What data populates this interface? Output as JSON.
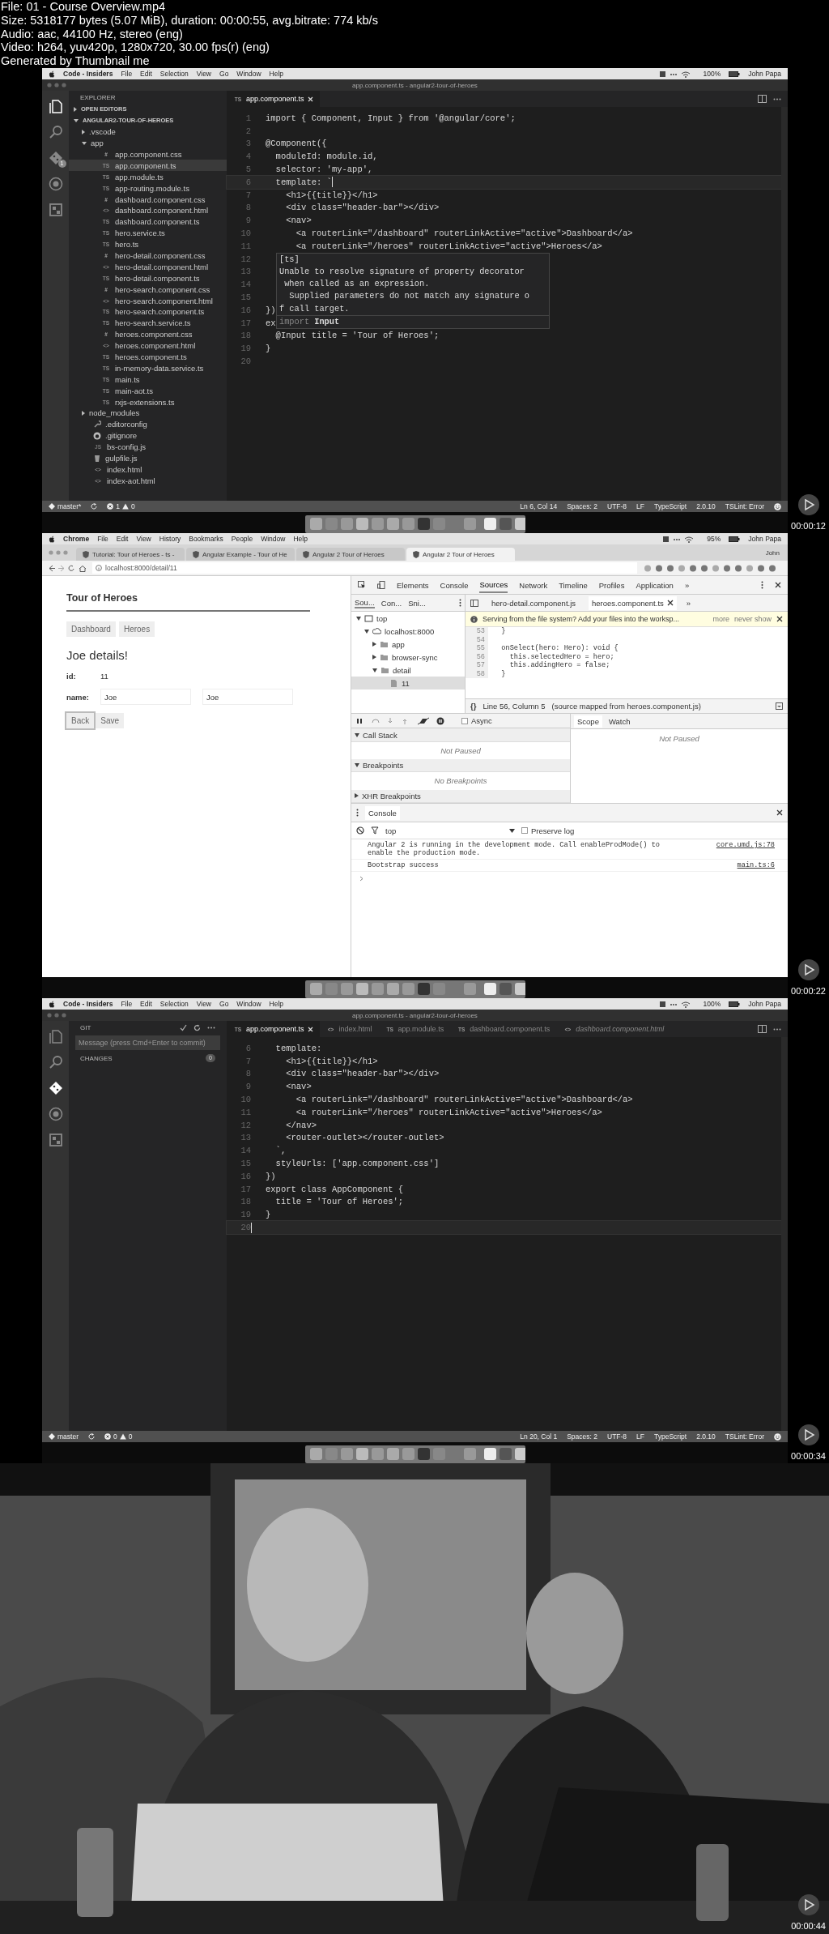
{
  "file_info": [
    "File: 01 - Course Overview.mp4",
    "Size: 5318177 bytes (5.07 MiB), duration: 00:00:55, avg.bitrate: 774 kb/s",
    "Audio: aac, 44100 Hz, stereo (eng)",
    "Video: h264, yuv420p, 1280x720, 30.00 fps(r) (eng)",
    "Generated by Thumbnail me"
  ],
  "frames": [
    {
      "kind": "vscode",
      "timestamp": "00:00:12",
      "menu_bar": {
        "app": "Code - Insiders",
        "items": [
          "File",
          "Edit",
          "Selection",
          "View",
          "Go",
          "Window",
          "Help"
        ],
        "battery": "100%",
        "user": "John Papa"
      },
      "window_title": "app.component.ts - angular2-tour-of-heroes",
      "activity": [
        {
          "kind": "files",
          "selected": true
        },
        {
          "kind": "search",
          "selected": false
        },
        {
          "kind": "git",
          "selected": false,
          "badge": "1"
        },
        {
          "kind": "debug",
          "selected": false
        },
        {
          "kind": "extensions",
          "selected": false
        }
      ],
      "sidebar": {
        "kind": "explorer",
        "title": "EXPLORER",
        "sections": [
          {
            "label": "OPEN EDITORS",
            "expanded": false
          },
          {
            "label": "ANGULAR2-TOUR-OF-HEROES",
            "expanded": true
          }
        ],
        "tree": [
          {
            "label": ".vscode",
            "kind": "folder",
            "expanded": false,
            "selected": false
          },
          {
            "label": "app",
            "kind": "folder",
            "expanded": true,
            "selected": false,
            "children": [
              {
                "label": "app.component.css",
                "kind": "css",
                "icon": "#",
                "selected": false
              },
              {
                "label": "app.component.ts",
                "kind": "ts",
                "icon": "TS",
                "selected": true
              },
              {
                "label": "app.module.ts",
                "kind": "ts",
                "icon": "TS",
                "selected": false
              },
              {
                "label": "app-routing.module.ts",
                "kind": "ts",
                "icon": "TS",
                "selected": false
              },
              {
                "label": "dashboard.component.css",
                "kind": "css",
                "icon": "#",
                "selected": false
              },
              {
                "label": "dashboard.component.html",
                "kind": "html",
                "icon": "<>",
                "selected": false
              },
              {
                "label": "dashboard.component.ts",
                "kind": "ts",
                "icon": "TS",
                "selected": false
              },
              {
                "label": "hero.service.ts",
                "kind": "ts",
                "icon": "TS",
                "selected": false
              },
              {
                "label": "hero.ts",
                "kind": "ts",
                "icon": "TS",
                "selected": false
              },
              {
                "label": "hero-detail.component.css",
                "kind": "css",
                "icon": "#",
                "selected": false
              },
              {
                "label": "hero-detail.component.html",
                "kind": "html",
                "icon": "<>",
                "selected": false
              },
              {
                "label": "hero-detail.component.ts",
                "kind": "ts",
                "icon": "TS",
                "selected": false
              },
              {
                "label": "hero-search.component.css",
                "kind": "css",
                "icon": "#",
                "selected": false
              },
              {
                "label": "hero-search.component.html",
                "kind": "html",
                "icon": "<>",
                "selected": false
              },
              {
                "label": "hero-search.component.ts",
                "kind": "ts",
                "icon": "TS",
                "selected": false
              },
              {
                "label": "hero-search.service.ts",
                "kind": "ts",
                "icon": "TS",
                "selected": false
              },
              {
                "label": "heroes.component.css",
                "kind": "css",
                "icon": "#",
                "selected": false
              },
              {
                "label": "heroes.component.html",
                "kind": "html",
                "icon": "<>",
                "selected": false
              },
              {
                "label": "heroes.component.ts",
                "kind": "ts",
                "icon": "TS",
                "selected": false
              },
              {
                "label": "in-memory-data.service.ts",
                "kind": "ts",
                "icon": "TS",
                "selected": false
              },
              {
                "label": "main.ts",
                "kind": "ts",
                "icon": "TS",
                "selected": false
              },
              {
                "label": "main-aot.ts",
                "kind": "ts",
                "icon": "TS",
                "selected": false
              },
              {
                "label": "rxjs-extensions.ts",
                "kind": "ts",
                "icon": "TS",
                "selected": false
              }
            ]
          },
          {
            "label": "node_modules",
            "kind": "folder",
            "expanded": false,
            "selected": false
          },
          {
            "label": ".editorconfig",
            "kind": "config",
            "selected": false
          },
          {
            "label": ".gitignore",
            "kind": "git",
            "selected": false
          },
          {
            "label": "bs-config.js",
            "kind": "js",
            "icon": "JS",
            "selected": false
          },
          {
            "label": "gulpfile.js",
            "kind": "gulp",
            "selected": false
          },
          {
            "label": "index.html",
            "kind": "html",
            "icon": "<>",
            "selected": false
          },
          {
            "label": "index-aot.html",
            "kind": "html",
            "icon": "<>",
            "selected": false
          }
        ]
      },
      "tabs": [
        {
          "label": "app.component.ts",
          "icon": "TS",
          "selected": true,
          "preview": false
        }
      ],
      "code": [
        {
          "n": "1",
          "text": "import { Component, Input } from '@angular/core';",
          "current": false
        },
        {
          "n": "2",
          "current": false
        },
        {
          "n": "3",
          "text": "@Component({",
          "current": false
        },
        {
          "n": "4",
          "text": "  moduleId: module.id,",
          "current": false
        },
        {
          "n": "5",
          "text": "  selector: 'my-app',",
          "current": false
        },
        {
          "n": "6",
          "text": "  template: `",
          "current": true
        },
        {
          "n": "7",
          "text": "    <h1>{{title}}</h1>",
          "current": false
        },
        {
          "n": "8",
          "text": "    <div class=\"header-bar\"></div>",
          "current": false
        },
        {
          "n": "9",
          "text": "    <nav>",
          "current": false
        },
        {
          "n": "10",
          "text": "      <a routerLink=\"/dashboard\" routerLinkActive=\"active\">Dashboard</a>",
          "current": false
        },
        {
          "n": "11",
          "text": "      <a routerLink=\"/heroes\" routerLinkActive=\"active\">Heroes</a>",
          "current": false
        },
        {
          "n": "12",
          "current": false
        },
        {
          "n": "13",
          "current": false
        },
        {
          "n": "14",
          "current": false
        },
        {
          "n": "15",
          "current": false
        },
        {
          "n": "16",
          "text": "})",
          "current": false
        },
        {
          "n": "17",
          "text": "ex",
          "current": false
        },
        {
          "n": "18",
          "text": "  @Input title = 'Tour of Heroes';",
          "current": false
        },
        {
          "n": "19",
          "text": "}",
          "current": false
        },
        {
          "n": "20",
          "current": false
        }
      ],
      "hover": {
        "heading": "[ts]",
        "message_lines": [
          "Unable to resolve signature of property decorator",
          " when called as an expression.",
          "  Supplied parameters do not match any signature o",
          "f call target."
        ],
        "keyword": "import",
        "name": "Input"
      },
      "status_bar": {
        "branch": "master*",
        "errors": "1",
        "warnings": "0",
        "items": [
          "Ln 6, Col 14",
          "Spaces: 2",
          "UTF-8",
          "LF",
          "TypeScript",
          "2.0.10",
          "TSLint: Error"
        ]
      }
    },
    {
      "kind": "chrome",
      "timestamp": "00:00:22",
      "menu_bar": {
        "app": "Chrome",
        "items": [
          "File",
          "Edit",
          "View",
          "History",
          "Bookmarks",
          "People",
          "Window",
          "Help"
        ],
        "battery": "95%",
        "user": "John Papa"
      },
      "tabs": [
        {
          "label": "Tutorial: Tour of Heroes - ts -",
          "selected": false
        },
        {
          "label": "Angular Example - Tour of He",
          "selected": false
        },
        {
          "label": "Angular 2 Tour of Heroes",
          "selected": false
        },
        {
          "label": "Angular 2 Tour of Heroes",
          "selected": true
        }
      ],
      "profile": "John",
      "address": "localhost:8000/detail/11",
      "page": {
        "title": "Tour of Heroes",
        "nav": [
          "Dashboard",
          "Heroes"
        ],
        "heading": "Joe details!",
        "id_label": "id:",
        "id_value": "11",
        "name_label": "name:",
        "name_values": [
          "Joe",
          "Joe"
        ],
        "buttons": [
          {
            "label": "Back",
            "focused": true
          },
          {
            "label": "Save",
            "focused": false
          }
        ]
      },
      "devtools": {
        "tabs": [
          {
            "label": "Elements",
            "selected": false
          },
          {
            "label": "Console",
            "selected": false
          },
          {
            "label": "Sources",
            "selected": true
          },
          {
            "label": "Network",
            "selected": false
          },
          {
            "label": "Timeline",
            "selected": false
          },
          {
            "label": "Profiles",
            "selected": false
          },
          {
            "label": "Application",
            "selected": false
          }
        ],
        "overflow": "»",
        "navigator_tabs": [
          {
            "label": "Sou...",
            "selected": true
          },
          {
            "label": "Con...",
            "selected": false
          },
          {
            "label": "Sni...",
            "selected": false
          }
        ],
        "tree": [
          {
            "label": "top",
            "kind": "frame",
            "expanded": true,
            "selected": false,
            "children": [
              {
                "label": "localhost:8000",
                "kind": "cloud",
                "expanded": true,
                "selected": false,
                "children": [
                  {
                    "label": "app",
                    "kind": "folder",
                    "expanded": false,
                    "selected": false
                  },
                  {
                    "label": "browser-sync",
                    "kind": "folder",
                    "expanded": false,
                    "selected": false
                  },
                  {
                    "label": "detail",
                    "kind": "folder",
                    "expanded": true,
                    "selected": false,
                    "children": [
                      {
                        "label": "11",
                        "kind": "file",
                        "selected": true
                      }
                    ]
                  }
                ]
              }
            ]
          }
        ],
        "editor_tabs": [
          {
            "label": "hero-detail.component.js",
            "selected": false
          },
          {
            "label": "heroes.component.ts",
            "selected": true
          }
        ],
        "editor_overflow": "»",
        "infobar": {
          "message": "Serving from the file system? Add your files into the worksp...",
          "actions": [
            "more",
            "never show"
          ]
        },
        "code": [
          {
            "n": "53",
            "text": "  }"
          },
          {
            "n": "54"
          },
          {
            "n": "55",
            "text": "  onSelect(hero: Hero): void {"
          },
          {
            "n": "56",
            "text": "    this.selectedHero = hero;"
          },
          {
            "n": "57",
            "text": "    this.addingHero = false;"
          },
          {
            "n": "58",
            "text": "  }"
          }
        ],
        "status": {
          "braces": "{}",
          "position": "Line 56, Column 5",
          "source": "(source mapped from heroes.component.js)"
        },
        "async": {
          "label": "Async",
          "checked": false
        },
        "panes": [
          {
            "label": "Call Stack",
            "expanded": true,
            "message": "Not Paused"
          },
          {
            "label": "Breakpoints",
            "expanded": true,
            "message": "No Breakpoints"
          },
          {
            "label": "XHR Breakpoints",
            "expanded": false
          }
        ],
        "side_tabs": [
          {
            "label": "Scope",
            "selected": true
          },
          {
            "label": "Watch",
            "selected": false
          }
        ],
        "side_message": "Not Paused",
        "console": {
          "title": "Console",
          "context": "top",
          "preserve_log": {
            "label": "Preserve log",
            "checked": false
          },
          "messages": [
            {
              "text": "Angular 2 is running in the development mode. Call enableProdMode() to\nenable the production mode.",
              "source": "core.umd.js:78"
            },
            {
              "text": "Bootstrap success",
              "source": "main.ts:6"
            }
          ]
        }
      }
    },
    {
      "kind": "vscode",
      "timestamp": "00:00:34",
      "menu_bar": {
        "app": "Code - Insiders",
        "items": [
          "File",
          "Edit",
          "Selection",
          "View",
          "Go",
          "Window",
          "Help"
        ],
        "battery": "100%",
        "user": "John Papa"
      },
      "window_title": "app.component.ts - angular2-tour-of-heroes",
      "activity": [
        {
          "kind": "files",
          "selected": false
        },
        {
          "kind": "search",
          "selected": false
        },
        {
          "kind": "git",
          "selected": true
        },
        {
          "kind": "debug",
          "selected": false
        },
        {
          "kind": "extensions",
          "selected": false
        }
      ],
      "sidebar": {
        "kind": "git",
        "title": "GIT",
        "message_placeholder": "Message (press Cmd+Enter to commit)",
        "changes_label": "CHANGES",
        "changes_count": "0"
      },
      "tabs": [
        {
          "label": "app.component.ts",
          "icon": "TS",
          "selected": true,
          "preview": false
        },
        {
          "label": "index.html",
          "icon": "<>",
          "selected": false,
          "preview": false
        },
        {
          "label": "app.module.ts",
          "icon": "TS",
          "selected": false,
          "preview": false
        },
        {
          "label": "dashboard.component.ts",
          "icon": "TS",
          "selected": false,
          "preview": false
        },
        {
          "label": "dashboard.component.html",
          "icon": "<>",
          "selected": false,
          "preview": true
        }
      ],
      "code": [
        {
          "n": "6",
          "text": "  template:",
          "current": false
        },
        {
          "n": "7",
          "text": "    <h1>{{title}}</h1>",
          "current": false
        },
        {
          "n": "8",
          "text": "    <div class=\"header-bar\"></div>",
          "current": false
        },
        {
          "n": "9",
          "text": "    <nav>",
          "current": false
        },
        {
          "n": "10",
          "text": "      <a routerLink=\"/dashboard\" routerLinkActive=\"active\">Dashboard</a>",
          "current": false
        },
        {
          "n": "11",
          "text": "      <a routerLink=\"/heroes\" routerLinkActive=\"active\">Heroes</a>",
          "current": false
        },
        {
          "n": "12",
          "text": "    </nav>",
          "current": false
        },
        {
          "n": "13",
          "text": "    <router-outlet></router-outlet>",
          "current": false
        },
        {
          "n": "14",
          "text": "  `,",
          "current": false
        },
        {
          "n": "15",
          "text": "  styleUrls: ['app.component.css']",
          "current": false
        },
        {
          "n": "16",
          "text": "})",
          "current": false
        },
        {
          "n": "17",
          "text": "export class AppComponent {",
          "current": false
        },
        {
          "n": "18",
          "text": "  title = 'Tour of Heroes';",
          "current": false
        },
        {
          "n": "19",
          "text": "}",
          "current": false
        },
        {
          "n": "20",
          "current": true
        }
      ],
      "status_bar": {
        "branch": "master",
        "errors": "0",
        "warnings": "0",
        "items": [
          "Ln 20, Col 1",
          "Spaces: 2",
          "UTF-8",
          "LF",
          "TypeScript",
          "2.0.10",
          "TSLint: Error"
        ]
      }
    },
    {
      "kind": "picture",
      "timestamp": "00:00:44"
    }
  ]
}
